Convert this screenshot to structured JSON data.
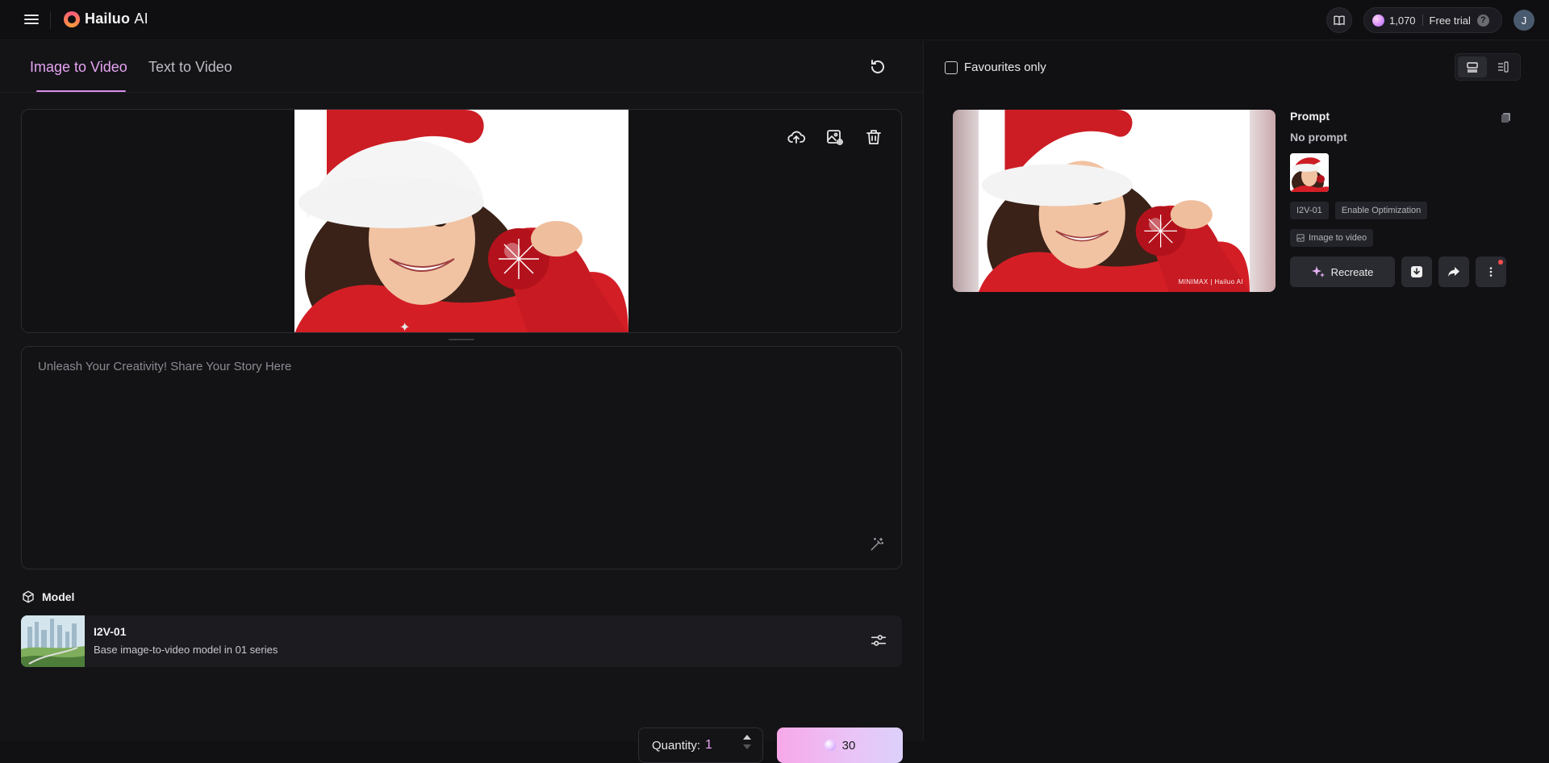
{
  "header": {
    "logo_name": "Hailuo",
    "logo_suffix": "AI",
    "credits": "1,070",
    "plan": "Free trial",
    "help": "?",
    "avatar_initial": "J"
  },
  "left": {
    "tabs": [
      {
        "label": "Image to Video",
        "active": true
      },
      {
        "label": "Text to Video",
        "active": false
      }
    ],
    "prompt": {
      "value": "",
      "placeholder": "Unleash Your Creativity! Share Your Story Here"
    },
    "model_section_label": "Model",
    "model": {
      "name": "I2V-01",
      "description": "Base image-to-video model in 01 series"
    },
    "quantity_label": "Quantity:",
    "quantity_value": "1",
    "generate_cost": "30"
  },
  "right": {
    "favourites_label": "Favourites only",
    "favourites_checked": false,
    "watermark": "MINIMAX | Hailuo AI",
    "info": {
      "title": "Prompt",
      "prompt_text": "No prompt",
      "chips": [
        "I2V-01",
        "Enable Optimization"
      ],
      "mode_chip": "Image to video",
      "recreate_label": "Recreate"
    }
  },
  "colors": {
    "accent": "#e6a4f2",
    "background": "#141417",
    "panel": "#111114",
    "notification": "#ff4d4d"
  },
  "icons": [
    "menu-icon",
    "book-icon",
    "gem-icon",
    "help-icon",
    "reset-icon",
    "upload-icon",
    "image-edit-icon",
    "trash-icon",
    "magic-wand-icon",
    "cube-icon",
    "sliders-icon",
    "copy-icon",
    "sparkle-icon",
    "download-icon",
    "share-icon",
    "more-icon"
  ]
}
